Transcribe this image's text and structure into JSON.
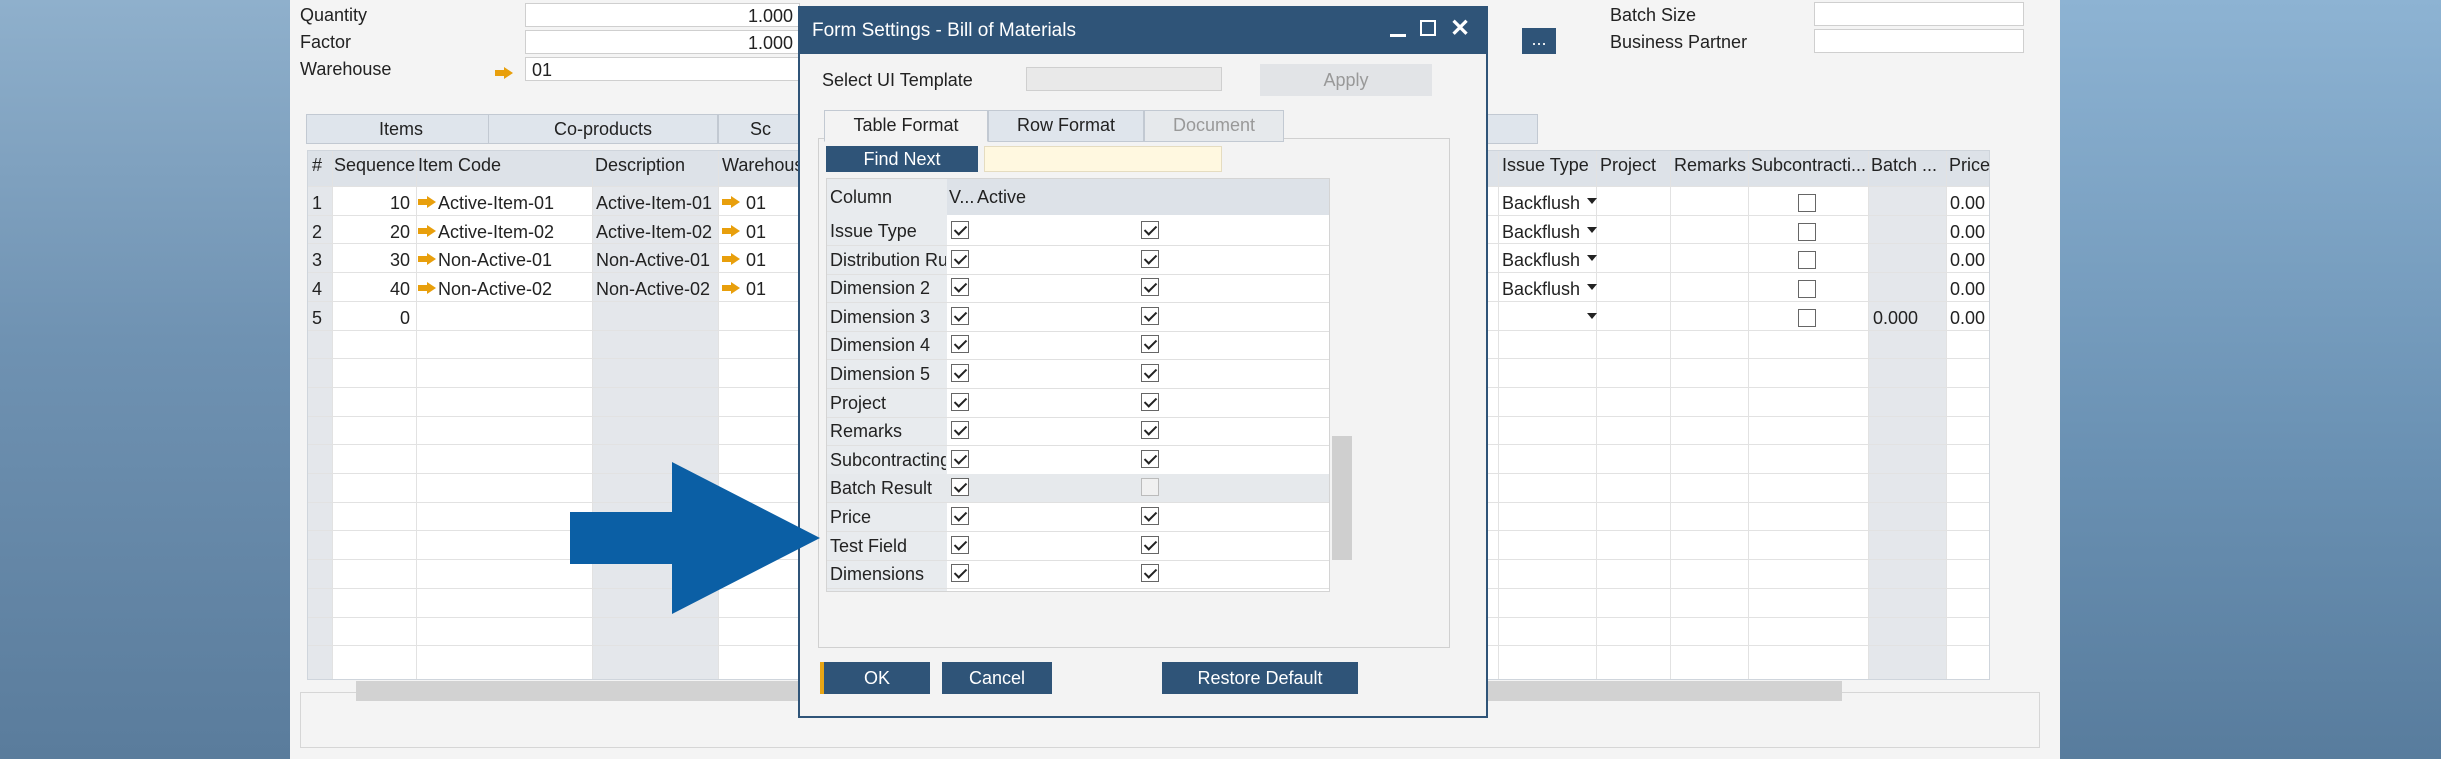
{
  "header_fields": {
    "quantity_label": "Quantity",
    "quantity_value": "1.000",
    "factor_label": "Factor",
    "factor_value": "1.000",
    "warehouse_label": "Warehouse",
    "warehouse_value": "01",
    "batch_size_label": "Batch Size",
    "business_partner_label": "Business Partner",
    "ellipsis_label": "..."
  },
  "main_tabs": [
    "Items",
    "Co-products",
    "Sc"
  ],
  "grid": {
    "columns_left": [
      "#",
      "Sequence",
      "Item Code",
      "Description",
      "Warehous"
    ],
    "columns_right": [
      "Issue Type",
      "Project",
      "Remarks",
      "Subcontracti...",
      "Batch ...",
      "Price"
    ],
    "rows": [
      {
        "num": "1",
        "seq": "10",
        "code": "Active-Item-01",
        "desc": "Active-Item-01",
        "wh": "01",
        "issue": "Backflush",
        "batch": "",
        "price": "0.00",
        "has_arrow": true
      },
      {
        "num": "2",
        "seq": "20",
        "code": "Active-Item-02",
        "desc": "Active-Item-02",
        "wh": "01",
        "issue": "Backflush",
        "batch": "",
        "price": "0.00",
        "has_arrow": true
      },
      {
        "num": "3",
        "seq": "30",
        "code": "Non-Active-01",
        "desc": "Non-Active-01",
        "wh": "01",
        "issue": "Backflush",
        "batch": "",
        "price": "0.00",
        "has_arrow": true
      },
      {
        "num": "4",
        "seq": "40",
        "code": "Non-Active-02",
        "desc": "Non-Active-02",
        "wh": "01",
        "issue": "Backflush",
        "batch": "",
        "price": "0.00",
        "has_arrow": true
      },
      {
        "num": "5",
        "seq": "0",
        "code": "",
        "desc": "",
        "wh": "",
        "issue": "",
        "batch": "0.000",
        "price": "0.00",
        "has_arrow": false
      }
    ]
  },
  "dialog": {
    "title": "Form Settings - Bill of Materials",
    "template_label": "Select UI Template",
    "apply_label": "Apply",
    "tabs": [
      "Table Format",
      "Row Format",
      "Document"
    ],
    "find_next_label": "Find Next",
    "col_header_column": "Column",
    "col_header_visible": "V...",
    "col_header_active": "Active",
    "rows": [
      {
        "name": "Issue Type",
        "visible": true,
        "active": true,
        "active_disabled": false
      },
      {
        "name": "Distribution Rul",
        "visible": true,
        "active": true,
        "active_disabled": false
      },
      {
        "name": "Dimension 2",
        "visible": true,
        "active": true,
        "active_disabled": false
      },
      {
        "name": "Dimension 3",
        "visible": true,
        "active": true,
        "active_disabled": false
      },
      {
        "name": "Dimension 4",
        "visible": true,
        "active": true,
        "active_disabled": false
      },
      {
        "name": "Dimension 5",
        "visible": true,
        "active": true,
        "active_disabled": false
      },
      {
        "name": "Project",
        "visible": true,
        "active": true,
        "active_disabled": false
      },
      {
        "name": "Remarks",
        "visible": true,
        "active": true,
        "active_disabled": false
      },
      {
        "name": "Subcontracting",
        "visible": true,
        "active": true,
        "active_disabled": false
      },
      {
        "name": "Batch Result",
        "visible": true,
        "active": false,
        "active_disabled": true
      },
      {
        "name": "Price",
        "visible": true,
        "active": true,
        "active_disabled": false
      },
      {
        "name": "Test Field",
        "visible": true,
        "active": true,
        "active_disabled": false
      },
      {
        "name": "Dimensions",
        "visible": true,
        "active": true,
        "active_disabled": false
      }
    ],
    "ok_label": "OK",
    "cancel_label": "Cancel",
    "restore_label": "Restore Default"
  },
  "colors": {
    "dialog_accent": "#2f5478",
    "arrow_callout": "#0b5fa5",
    "link_arrow": "#e89f0c"
  }
}
